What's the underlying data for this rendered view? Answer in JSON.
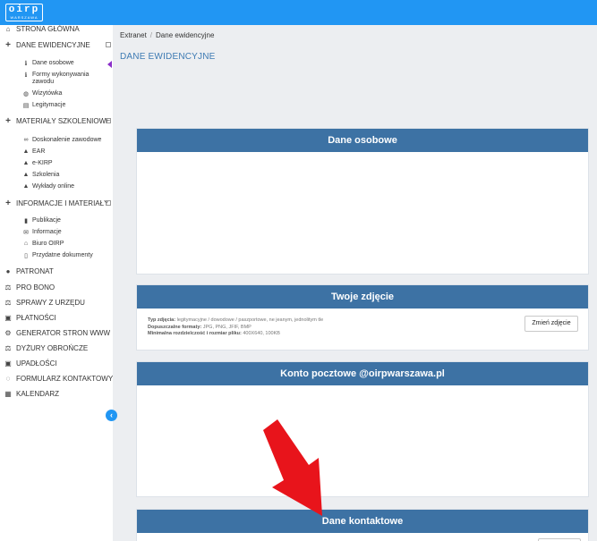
{
  "logo": {
    "main": "oirp",
    "sub": "WARSZAWA"
  },
  "sidebar": {
    "items": [
      {
        "label": "STRONA GŁÓWNA",
        "icon": "home-icon"
      },
      {
        "label": "DANE EWIDENCYJNE",
        "icon": "plus-icon"
      },
      {
        "label": "MATERIAŁY SZKOLENIOWE",
        "icon": "plus-icon"
      },
      {
        "label": "INFORMACJE I MATERIAŁY",
        "icon": "plus-icon"
      },
      {
        "label": "PATRONAT",
        "icon": "user-icon"
      },
      {
        "label": "PRO BONO",
        "icon": "scales-icon"
      },
      {
        "label": "SPRAWY Z URZĘDU",
        "icon": "scales-icon"
      },
      {
        "label": "PŁATNOŚCI",
        "icon": "money-icon"
      },
      {
        "label": "GENERATOR STRON WWW",
        "icon": "gears-icon"
      },
      {
        "label": "DYŻURY OBROŃCZE",
        "icon": "scales-icon"
      },
      {
        "label": "UPADŁOŚCI",
        "icon": "money-icon"
      },
      {
        "label": "FORMULARZ KONTAKTOWY",
        "icon": "comments-icon"
      },
      {
        "label": "KALENDARZ",
        "icon": "calendar-icon"
      }
    ],
    "dane_sub": [
      {
        "label": "Dane osobowe",
        "icon": "info-icon"
      },
      {
        "label": "Formy wykonywania zawodu",
        "icon": "info-icon"
      },
      {
        "label": "Wizytówka",
        "icon": "globe-icon"
      },
      {
        "label": "Legitymacje",
        "icon": "id-card-icon"
      }
    ],
    "materialy_sub": [
      {
        "label": "Doskonalenie zawodowe",
        "icon": "link-icon"
      },
      {
        "label": "EAR",
        "icon": "graduation-cap-icon"
      },
      {
        "label": "e-KIRP",
        "icon": "graduation-cap-icon"
      },
      {
        "label": "Szkolenia",
        "icon": "graduation-cap-icon"
      },
      {
        "label": "Wykłady online",
        "icon": "graduation-cap-icon"
      }
    ],
    "informacje_sub": [
      {
        "label": "Publikacje",
        "icon": "book-icon"
      },
      {
        "label": "Informacje",
        "icon": "envelope-icon"
      },
      {
        "label": "Biuro OIRP",
        "icon": "bank-icon"
      },
      {
        "label": "Przydatne dokumenty",
        "icon": "document-icon"
      }
    ]
  },
  "breadcrumb": {
    "root": "Extranet",
    "current": "Dane ewidencyjne"
  },
  "page_title": "DANE EWIDENCYJNE",
  "panels": {
    "personal": {
      "title": "Dane osobowe"
    },
    "photo": {
      "title": "Twoje zdjęcie",
      "info_type_label": "Typ zdjęcia:",
      "info_type_value": "legitymacyjne / dowodowe / paszportowe, ne jeanym, jednolitym tle",
      "info_formats_label": "Dopuszczalne formaty:",
      "info_formats_value": "JPG, PNG, JFIF, BMP",
      "info_size_label": "Minimalna rozdzielczość i rozmiar pliku:",
      "info_size_value": "400X640, 100KB",
      "change_button": "Zmień zdjęcie"
    },
    "mail": {
      "title": "Konto pocztowe @oirpwarszawa.pl"
    },
    "contact": {
      "title": "Dane kontaktowe"
    }
  },
  "colors": {
    "topbar": "#2196f3",
    "panel_header": "#3d72a4",
    "annotation_arrow": "#e8141b"
  }
}
